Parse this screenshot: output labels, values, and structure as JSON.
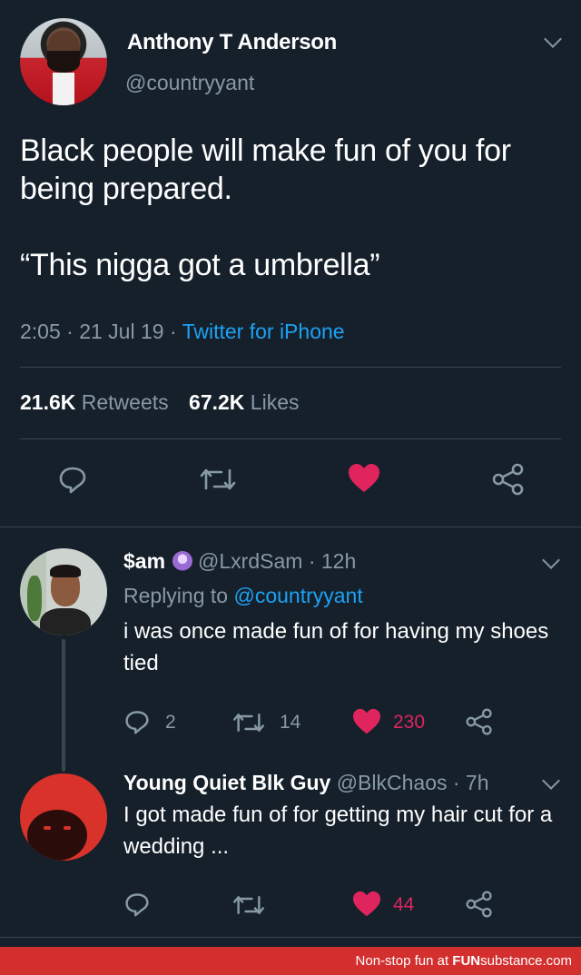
{
  "tweet": {
    "author_name": "Anthony T Anderson",
    "author_handle": "@countryyant",
    "text_line1": "Black people will make fun of you for being prepared.",
    "text_line2": "“This nigga got a umbrella”",
    "time": "2:05 · 21 Jul 19 ·",
    "source": "Twitter for iPhone",
    "retweets_count": "21.6K",
    "retweets_label": "Retweets",
    "likes_count": "67.2K",
    "likes_label": "Likes",
    "icons": [
      "reply-icon",
      "retweet-icon",
      "heart-icon",
      "share-icon"
    ]
  },
  "replies": [
    {
      "author_name": "$am",
      "author_handle": "@LxrdSam · 12h",
      "replying_prefix": "Replying to",
      "replying_to": "@countryyant",
      "text": "i was once made fun of for having my shoes tied",
      "reply_count": "2",
      "retweet_count": "14",
      "like_count": "230"
    },
    {
      "author_name": "Young Quiet Blk Guy",
      "author_handle": "@BlkChaos · 7h",
      "text": "I got made fun of for getting my hair cut for a wedding ...",
      "like_count": "44"
    }
  ],
  "footer": {
    "prefix": "Non-stop fun at ",
    "brand_bold": "FUN",
    "brand_rest": "substance.com"
  },
  "colors": {
    "background": "#15202b",
    "accent": "#1da1f2",
    "like": "#e0245e",
    "muted": "#8899a6",
    "footer": "#d32f2f"
  }
}
